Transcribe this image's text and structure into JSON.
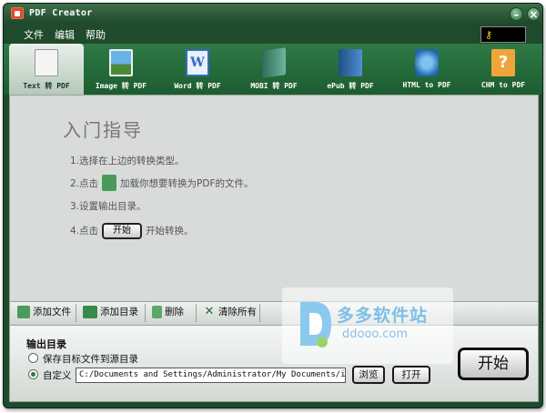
{
  "window": {
    "title": "PDF Creator"
  },
  "menu": [
    "文件",
    "编辑",
    "帮助"
  ],
  "tabs": [
    {
      "label": "Text 转 PDF",
      "icon": "text-document-icon",
      "color": "#dcdcdc",
      "active": true
    },
    {
      "label": "Image 转 PDF",
      "icon": "image-icon",
      "color": "#3a8fc9"
    },
    {
      "label": "Word 转 PDF",
      "icon": "word-icon",
      "color": "#2f6ec0"
    },
    {
      "label": "MOBI 转 PDF",
      "icon": "mobi-book-icon",
      "color": "#4d8f7a"
    },
    {
      "label": "ePub 转 PDF",
      "icon": "epub-book-icon",
      "color": "#2f6aa8"
    },
    {
      "label": "HTML to PDF",
      "icon": "html-icon",
      "color": "#2d7ec4"
    },
    {
      "label": "CHM to PDF",
      "icon": "chm-help-icon",
      "color": "#f0a53a"
    }
  ],
  "guide": {
    "title": "入门指导",
    "step1": "1.选择在上边的转换类型。",
    "step2_pre": "2.点击",
    "step2_post": "加载你想要转换为PDF的文件。",
    "step3": "3.设置输出目录。",
    "step4_pre": "4.点击",
    "step4_button": "开始",
    "step4_post": "开始转换。"
  },
  "actions": {
    "add_file": "添加文件",
    "add_dir": "添加目录",
    "delete": "删除",
    "clear_all": "清除所有"
  },
  "output": {
    "title": "输出目录",
    "option_source": "保存目标文件到源目录",
    "option_custom": "自定义",
    "selected": "custom",
    "path": "C:/Documents and Settings/Administrator/My Documents/iStonsoft",
    "browse": "浏览",
    "open": "打开",
    "start": "开始"
  },
  "watermark": {
    "name": "多多软件站",
    "url": "ddooo.com"
  },
  "colors": {
    "frame": "#1f4a2c",
    "toolbar": "#2f7a46",
    "content": "#d8dbd9"
  }
}
